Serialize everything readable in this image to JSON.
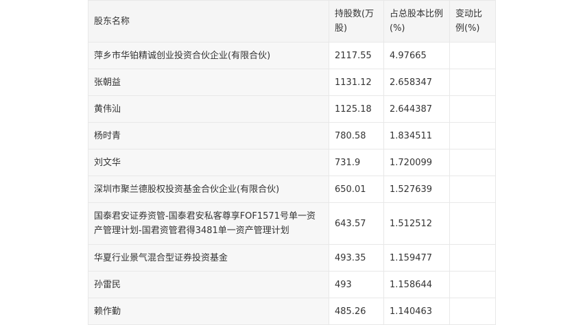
{
  "table": {
    "headers": [
      "股东名称",
      "持股数(万股)",
      "占总股本比例(%)",
      "变动比例(%)"
    ],
    "rows": [
      {
        "name": "萍乡市华铂精诚创业投资合伙企业(有限合伙)",
        "shares": "2117.55",
        "ratio": "4.97665",
        "change": ""
      },
      {
        "name": "张朝益",
        "shares": "1131.12",
        "ratio": "2.658347",
        "change": ""
      },
      {
        "name": "黄伟汕",
        "shares": "1125.18",
        "ratio": "2.644387",
        "change": ""
      },
      {
        "name": "杨时青",
        "shares": "780.58",
        "ratio": "1.834511",
        "change": ""
      },
      {
        "name": "刘文华",
        "shares": "731.9",
        "ratio": "1.720099",
        "change": ""
      },
      {
        "name": "深圳市聚兰德股权投资基金合伙企业(有限合伙)",
        "shares": "650.01",
        "ratio": "1.527639",
        "change": ""
      },
      {
        "name": "国泰君安证券资管-国泰君安私客尊享FOF1571号单一资产管理计划-国君资管君得3481单一资产管理计划",
        "shares": "643.57",
        "ratio": "1.512512",
        "change": ""
      },
      {
        "name": "华夏行业景气混合型证券投资基金",
        "shares": "493.35",
        "ratio": "1.159477",
        "change": ""
      },
      {
        "name": "孙雷民",
        "shares": "493",
        "ratio": "1.158644",
        "change": ""
      },
      {
        "name": "赖作勤",
        "shares": "485.26",
        "ratio": "1.140463",
        "change": ""
      }
    ]
  }
}
